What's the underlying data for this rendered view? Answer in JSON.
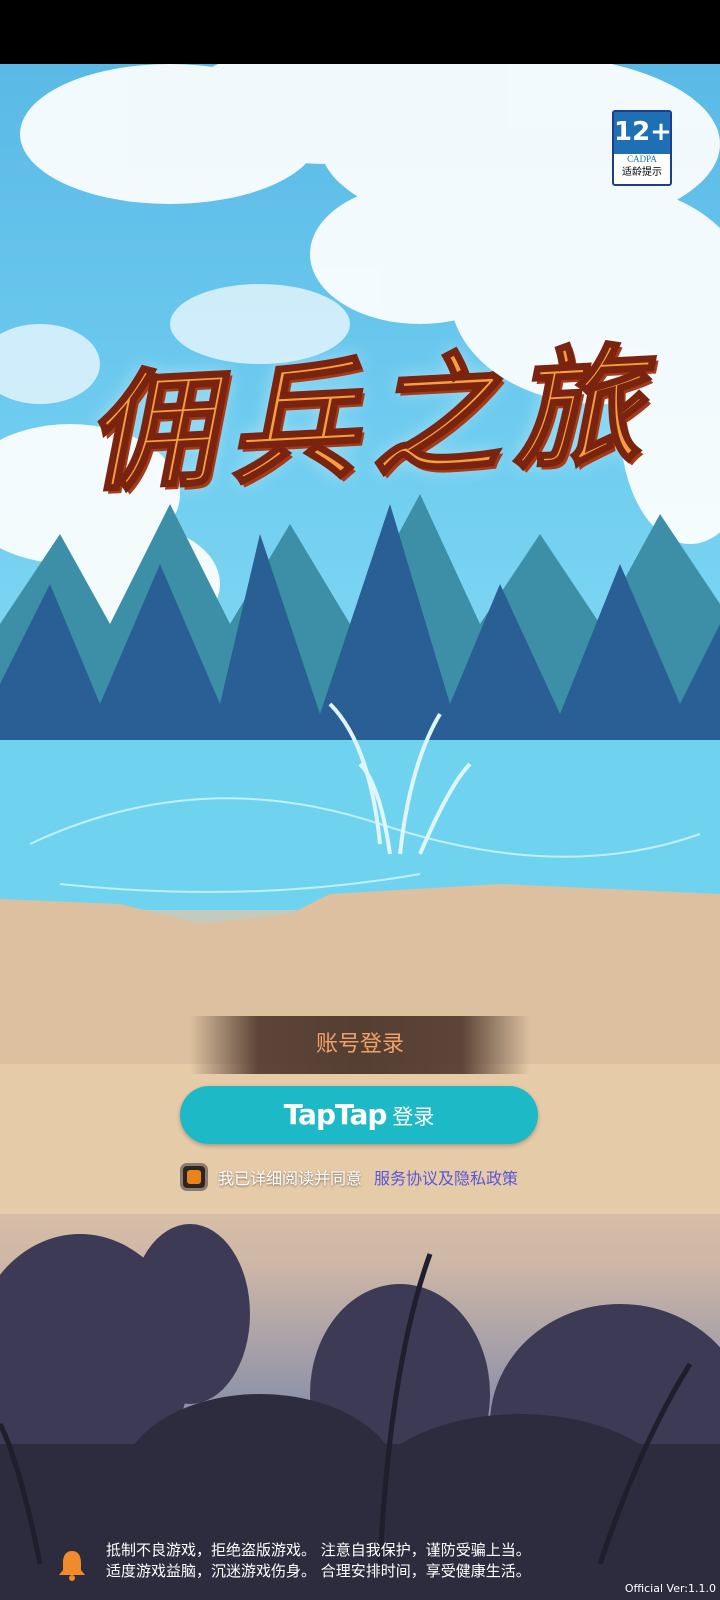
{
  "game": {
    "title": "佣兵之旅"
  },
  "age_rating": {
    "label": "12+",
    "org": "CADPA",
    "caption": "适龄提示"
  },
  "login": {
    "account_label": "账号登录",
    "taptap_brand": "TapTap",
    "taptap_suffix": "登录"
  },
  "agreement": {
    "checked": true,
    "text": "我已详细阅读并同意",
    "link_text": "服务协议及隐私政策",
    "link_color": "#5b56d6"
  },
  "notice": {
    "line1": "抵制不良游戏，拒绝盗版游戏。 注意自我保护，谨防受骗上当。",
    "line2": "适度游戏益脑，沉迷游戏伤身。 合理安排时间，享受健康生活。"
  },
  "version": "Official Ver:1.1.0",
  "colors": {
    "taptap": "#1db9c7",
    "account_text": "#f2a06a",
    "checkbox_fill": "#e98418"
  },
  "icons": {
    "notice": "bell-icon"
  }
}
